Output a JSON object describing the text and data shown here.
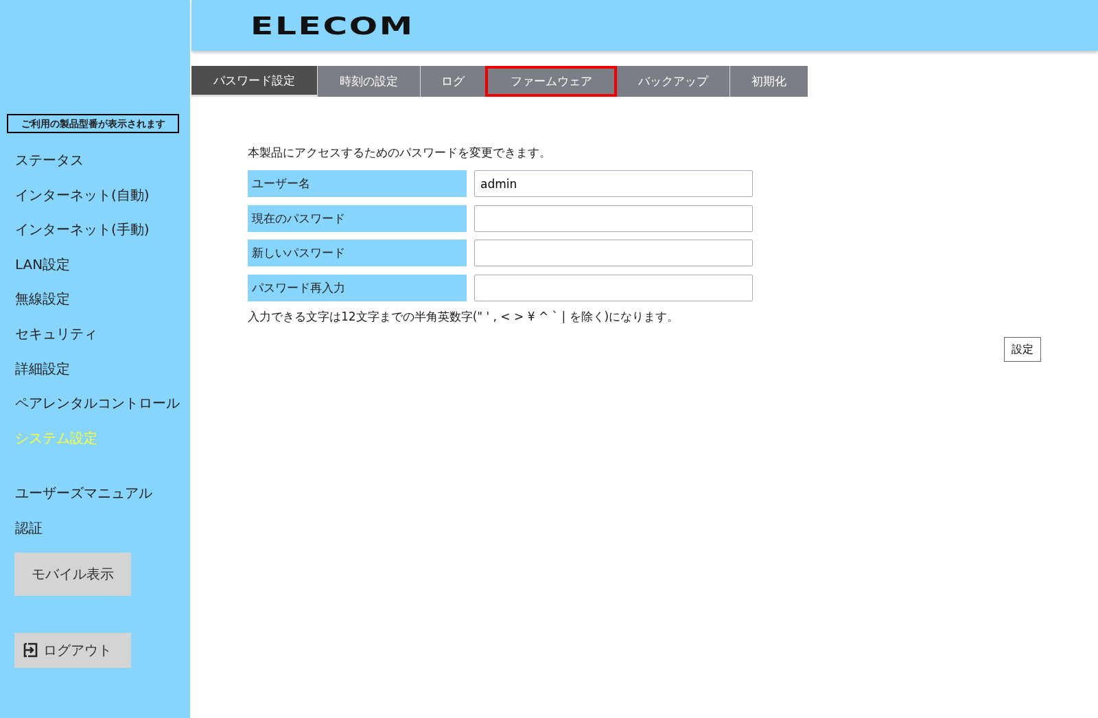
{
  "header": {
    "logo": "ELECOM"
  },
  "sidebar": {
    "model_label": "ご利用の製品型番が表示されます",
    "items": [
      {
        "label": "ステータス",
        "selected": false
      },
      {
        "label": "インターネット(自動)",
        "selected": false
      },
      {
        "label": "インターネット(手動)",
        "selected": false
      },
      {
        "label": "LAN設定",
        "selected": false
      },
      {
        "label": "無線設定",
        "selected": false
      },
      {
        "label": "セキュリティ",
        "selected": false
      },
      {
        "label": "詳細設定",
        "selected": false
      },
      {
        "label": "ペアレンタルコントロール",
        "selected": false
      },
      {
        "label": "システム設定",
        "selected": true
      }
    ],
    "links": [
      "ユーザーズマニュアル",
      "認証"
    ],
    "mobile_button": "モバイル表示",
    "logout_button": "ログアウト"
  },
  "tabs": [
    {
      "label": "パスワード設定",
      "selected": true,
      "highlighted": false
    },
    {
      "label": "時刻の設定",
      "selected": false,
      "highlighted": false
    },
    {
      "label": "ログ",
      "selected": false,
      "highlighted": false
    },
    {
      "label": "ファームウェア",
      "selected": false,
      "highlighted": true
    },
    {
      "label": "バックアップ",
      "selected": false,
      "highlighted": false
    },
    {
      "label": "初期化",
      "selected": false,
      "highlighted": false
    }
  ],
  "intro": "本製品にアクセスするためのパスワードを変更できます。",
  "fields": [
    {
      "label": "ユーザー名",
      "value": "admin"
    },
    {
      "label": "現在のパスワード"
    },
    {
      "label": "新しいパスワード"
    },
    {
      "label": "パスワード再入力"
    }
  ],
  "note": "入力できる文字は12文字までの半角英数字(\" ' , < > ¥ ^ ` | を除く)になります。",
  "submit_button": "設定"
}
